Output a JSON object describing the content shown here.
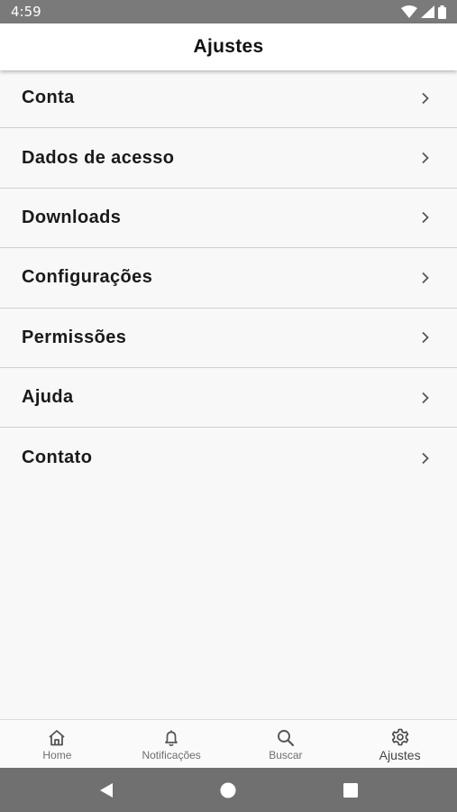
{
  "status_bar": {
    "time": "4:59",
    "icons": [
      "wifi-icon",
      "signal-icon",
      "battery-icon"
    ]
  },
  "header": {
    "title": "Ajustes"
  },
  "menu": {
    "items": [
      {
        "label": "Conta",
        "icon": "chevron-right-icon"
      },
      {
        "label": "Dados de acesso",
        "icon": "chevron-right-icon"
      },
      {
        "label": "Downloads",
        "icon": "chevron-right-icon"
      },
      {
        "label": "Configurações",
        "icon": "chevron-right-icon"
      },
      {
        "label": "Permissões",
        "icon": "chevron-right-icon"
      },
      {
        "label": "Ajuda",
        "icon": "chevron-right-icon"
      },
      {
        "label": "Contato",
        "icon": "chevron-right-icon"
      }
    ]
  },
  "bottom_nav": {
    "items": [
      {
        "label": "Home",
        "icon": "home-icon",
        "active": false
      },
      {
        "label": "Notificações",
        "icon": "bell-icon",
        "active": false
      },
      {
        "label": "Buscar",
        "icon": "search-icon",
        "active": false
      },
      {
        "label": "Ajustes",
        "icon": "gear-icon",
        "active": true
      }
    ]
  },
  "system_nav": {
    "buttons": [
      "back-icon",
      "home-circle-icon",
      "recents-square-icon"
    ]
  },
  "colors": {
    "status_bar_bg": "#7a7a7a",
    "system_nav_bg": "#707070",
    "page_bg": "#f8f8f8",
    "header_bg": "#ffffff",
    "divider": "#cfcfcf"
  }
}
